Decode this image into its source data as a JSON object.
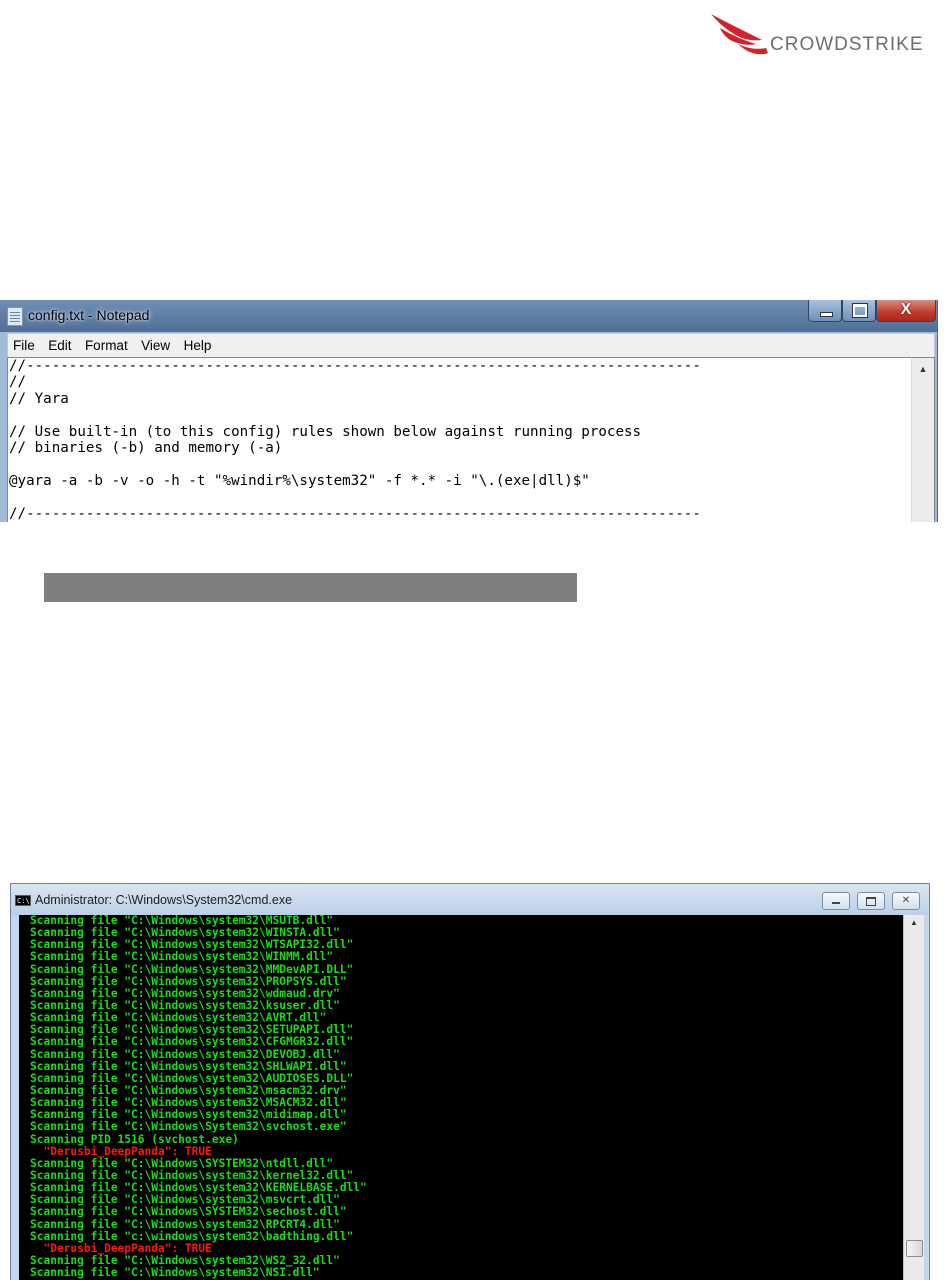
{
  "logo": {
    "text": "CROWDSTRIKE"
  },
  "notepad": {
    "title": "config.txt - Notepad",
    "menu": [
      "File",
      "Edit",
      "Format",
      "View",
      "Help"
    ],
    "lines": [
      "//-------------------------------------------------------------------------------",
      "//",
      "// Yara",
      "",
      "// Use built-in (to this config) rules shown below against running process",
      "// binaries (-b) and memory (-a)",
      "",
      "@yara -a -b -v -o -h -t \"%windir%\\system32\" -f *.* -i \"\\.(exe|dll)$\"",
      "",
      "//-------------------------------------------------------------------------------"
    ]
  },
  "cmd": {
    "title": "Administrator: C:\\Windows\\System32\\cmd.exe",
    "icon_label": "C:\\",
    "lines": [
      {
        "text": "Scanning file \"C:\\Windows\\system32\\MSUTB.dll\"",
        "color": "green"
      },
      {
        "text": "Scanning file \"C:\\Windows\\system32\\WINSTA.dll\"",
        "color": "green"
      },
      {
        "text": "Scanning file \"C:\\Windows\\system32\\WTSAPI32.dll\"",
        "color": "green"
      },
      {
        "text": "Scanning file \"C:\\Windows\\system32\\WINMM.dll\"",
        "color": "green"
      },
      {
        "text": "Scanning file \"C:\\Windows\\system32\\MMDevAPI.DLL\"",
        "color": "green"
      },
      {
        "text": "Scanning file \"C:\\Windows\\system32\\PROPSYS.dll\"",
        "color": "green"
      },
      {
        "text": "Scanning file \"C:\\Windows\\system32\\wdmaud.drv\"",
        "color": "green"
      },
      {
        "text": "Scanning file \"C:\\Windows\\system32\\ksuser.dll\"",
        "color": "green"
      },
      {
        "text": "Scanning file \"C:\\Windows\\system32\\AVRT.dll\"",
        "color": "green"
      },
      {
        "text": "Scanning file \"C:\\Windows\\system32\\SETUPAPI.dll\"",
        "color": "green"
      },
      {
        "text": "Scanning file \"C:\\Windows\\system32\\CFGMGR32.dll\"",
        "color": "green"
      },
      {
        "text": "Scanning file \"C:\\Windows\\system32\\DEVOBJ.dll\"",
        "color": "green"
      },
      {
        "text": "Scanning file \"C:\\Windows\\system32\\SHLWAPI.dll\"",
        "color": "green"
      },
      {
        "text": "Scanning file \"C:\\Windows\\system32\\AUDIOSES.DLL\"",
        "color": "green"
      },
      {
        "text": "Scanning file \"C:\\Windows\\system32\\msacm32.drv\"",
        "color": "green"
      },
      {
        "text": "Scanning file \"C:\\Windows\\system32\\MSACM32.dll\"",
        "color": "green"
      },
      {
        "text": "Scanning file \"C:\\Windows\\system32\\midimap.dll\"",
        "color": "green"
      },
      {
        "text": "Scanning file \"C:\\Windows\\System32\\svchost.exe\"",
        "color": "green"
      },
      {
        "text": "Scanning PID 1516 (svchost.exe)",
        "color": "green"
      },
      {
        "text": "  \"Derusbi_DeepPanda\": TRUE",
        "color": "red"
      },
      {
        "text": "Scanning file \"C:\\Windows\\SYSTEM32\\ntdll.dll\"",
        "color": "green"
      },
      {
        "text": "Scanning file \"C:\\Windows\\system32\\kernel32.dll\"",
        "color": "green"
      },
      {
        "text": "Scanning file \"C:\\Windows\\system32\\KERNELBASE.dll\"",
        "color": "green"
      },
      {
        "text": "Scanning file \"C:\\Windows\\system32\\msvcrt.dll\"",
        "color": "green"
      },
      {
        "text": "Scanning file \"C:\\Windows\\SYSTEM32\\sechost.dll\"",
        "color": "green"
      },
      {
        "text": "Scanning file \"C:\\Windows\\system32\\RPCRT4.dll\"",
        "color": "green"
      },
      {
        "text": "Scanning file \"c:\\windows\\system32\\badthing.dll\"",
        "color": "green"
      },
      {
        "text": "  \"Derusbi_DeepPanda\": TRUE",
        "color": "red"
      },
      {
        "text": "Scanning file \"C:\\Windows\\system32\\WS2_32.dll\"",
        "color": "green"
      },
      {
        "text": "Scanning file \"C:\\Windows\\system32\\NSI.dll\"",
        "color": "green"
      }
    ]
  },
  "colors": {
    "console_green": "#14e014",
    "console_red": "#ff1515",
    "console_bg": "#000000",
    "grey_bar": "#7f7f7f"
  }
}
